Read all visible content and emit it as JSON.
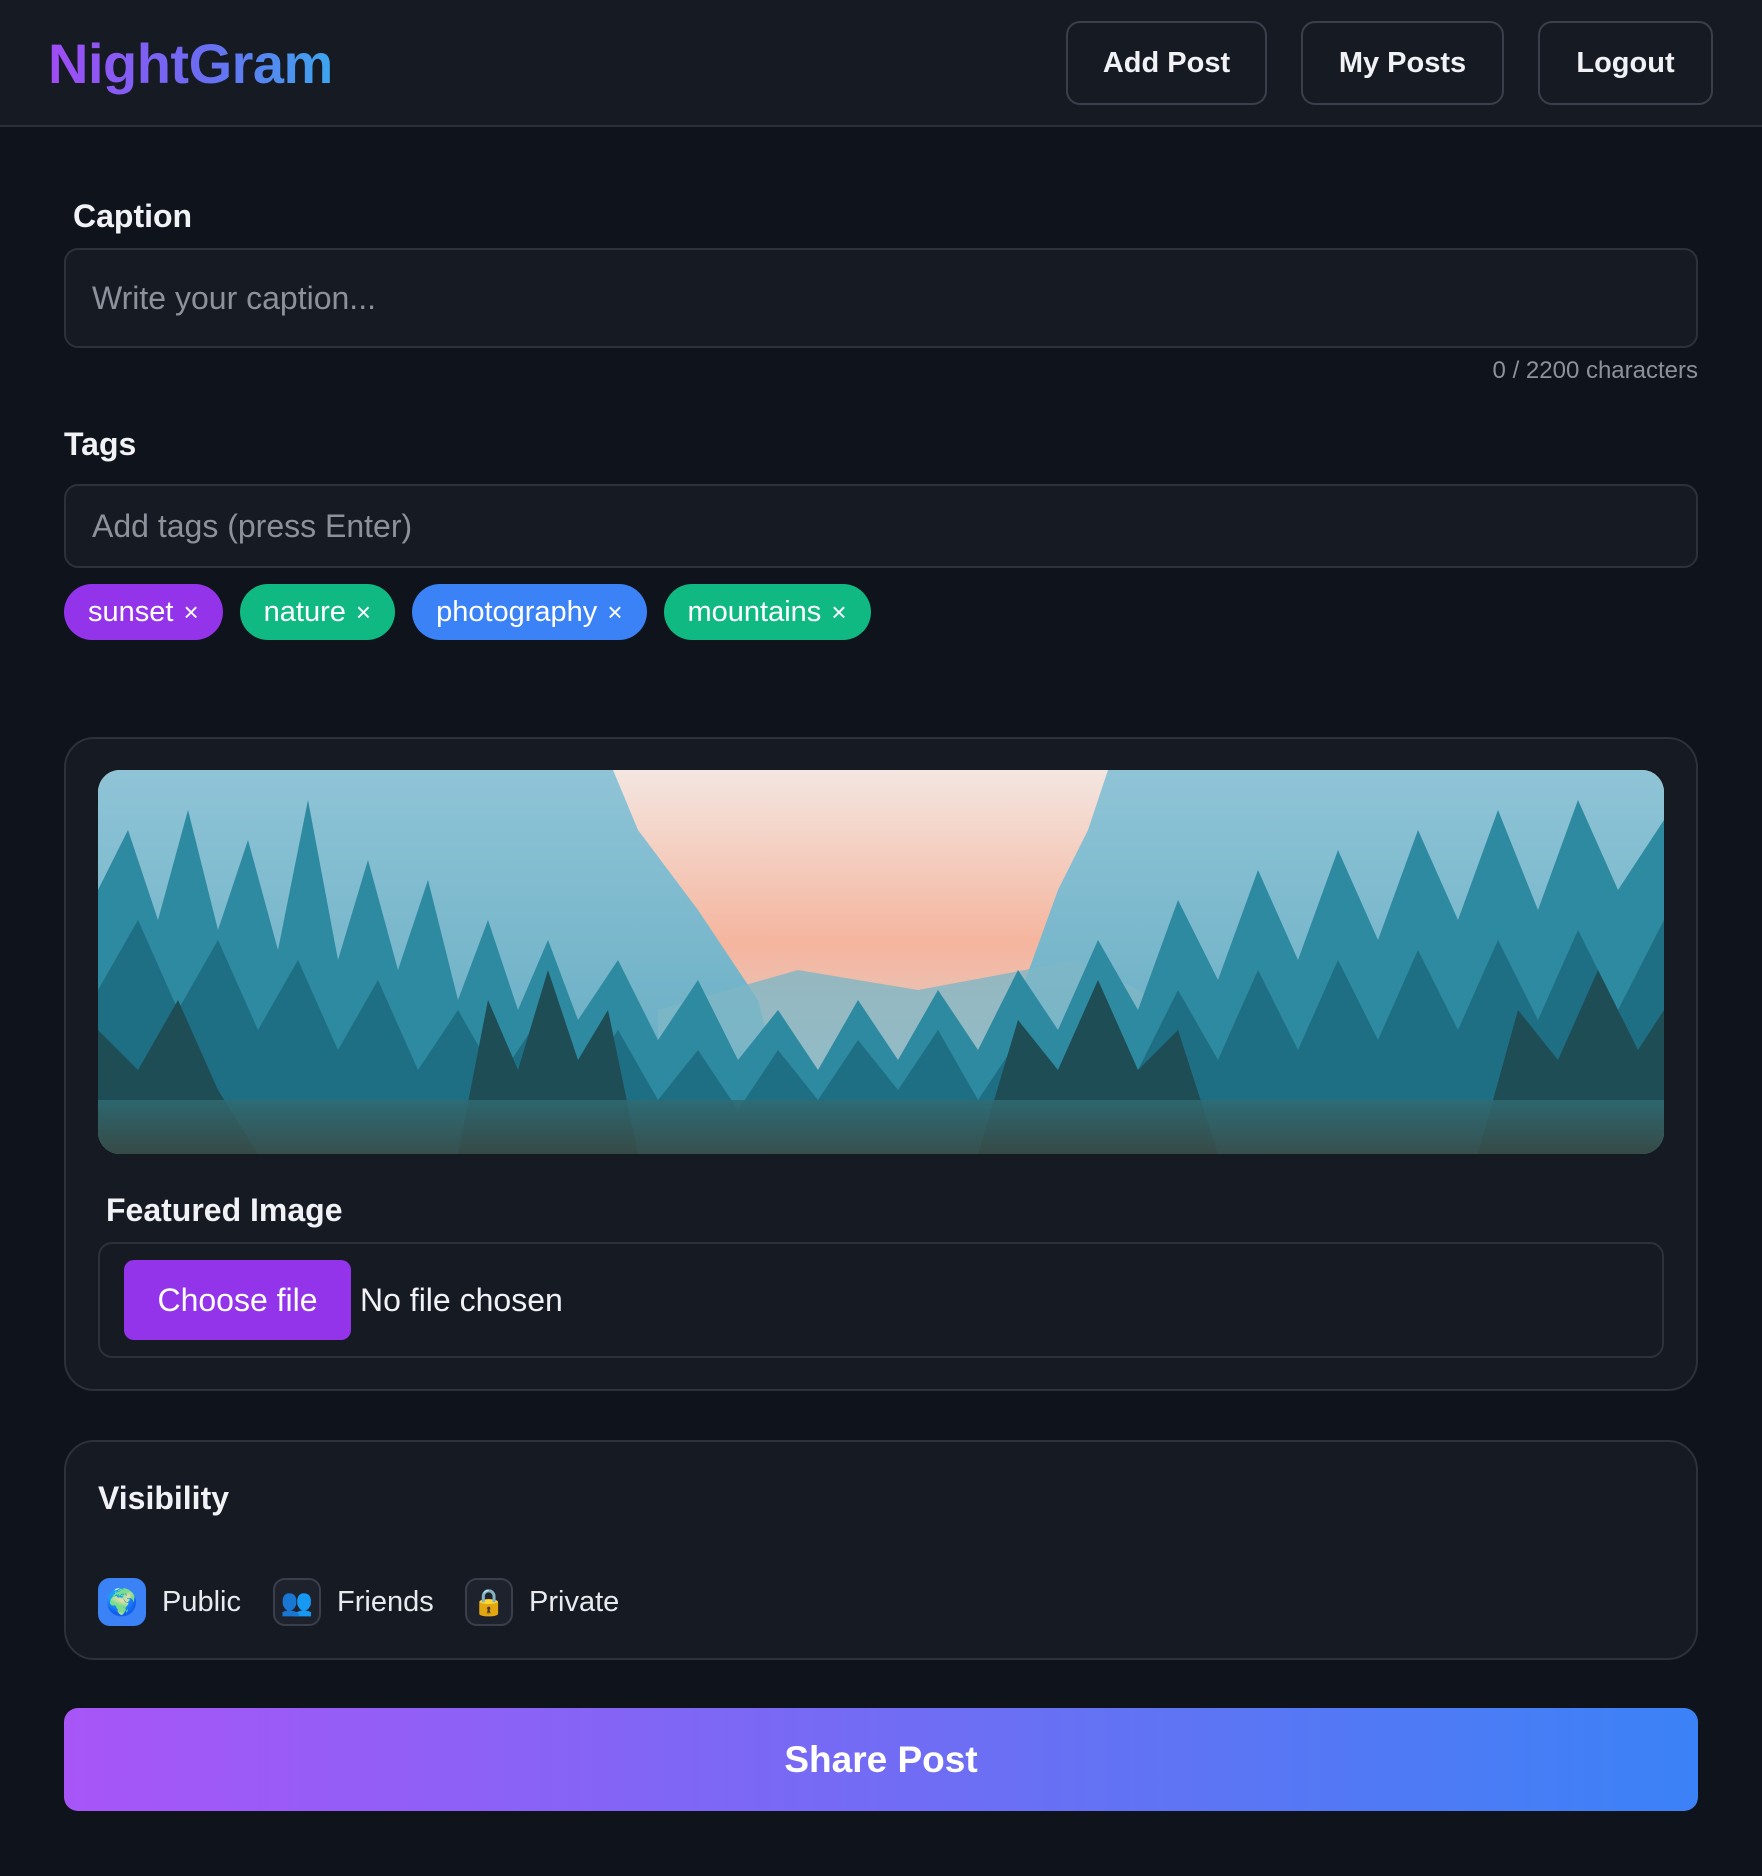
{
  "app": {
    "title": "NightGram"
  },
  "nav": {
    "add_post": "Add Post",
    "my_posts": "My Posts",
    "logout": "Logout"
  },
  "caption": {
    "label": "Caption",
    "placeholder": "Write your caption...",
    "value": "",
    "counter": "0 / 2200 characters"
  },
  "tags": {
    "label": "Tags",
    "placeholder": "Add tags (press Enter)",
    "items": [
      {
        "label": "sunset",
        "remove": "×",
        "color": "#9333ea"
      },
      {
        "label": "nature",
        "remove": "×",
        "color": "#10b981"
      },
      {
        "label": "photography",
        "remove": "×",
        "color": "#3b82f6"
      },
      {
        "label": "mountains",
        "remove": "×",
        "color": "#10b981"
      }
    ]
  },
  "featured_image": {
    "label": "Featured Image",
    "choose_button": "Choose file",
    "status": "No file chosen"
  },
  "visibility": {
    "label": "Visibility",
    "options": [
      {
        "label": "Public",
        "icon": "🌍",
        "icon_name": "globe-icon",
        "selected": true
      },
      {
        "label": "Friends",
        "icon": "👥",
        "icon_name": "people-icon",
        "selected": false
      },
      {
        "label": "Private",
        "icon": "🔒",
        "icon_name": "lock-icon",
        "selected": false
      }
    ]
  },
  "share": {
    "label": "Share Post"
  },
  "colors": {
    "background": "#0f131b",
    "surface": "#161a23",
    "accent_purple": "#9333ea",
    "accent_blue": "#3b82f6",
    "accent_green": "#10b981"
  }
}
